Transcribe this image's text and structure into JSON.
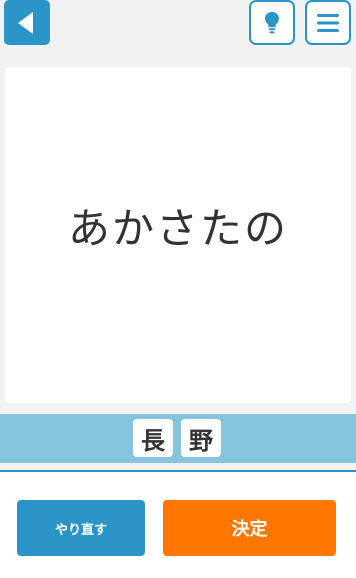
{
  "toolbar": {
    "back_icon": "back-triangle-icon",
    "hint_icon": "lightbulb-icon",
    "menu_icon": "hamburger-menu-icon",
    "accent_color": "#2c95c8"
  },
  "canvas": {
    "ink_text": "あかさたの"
  },
  "candidates": {
    "items": [
      "長",
      "野"
    ],
    "bar_color": "#86c3df"
  },
  "actions": {
    "redo_label": "やり直す",
    "decide_label": "決定",
    "decide_color": "#ff7700"
  }
}
